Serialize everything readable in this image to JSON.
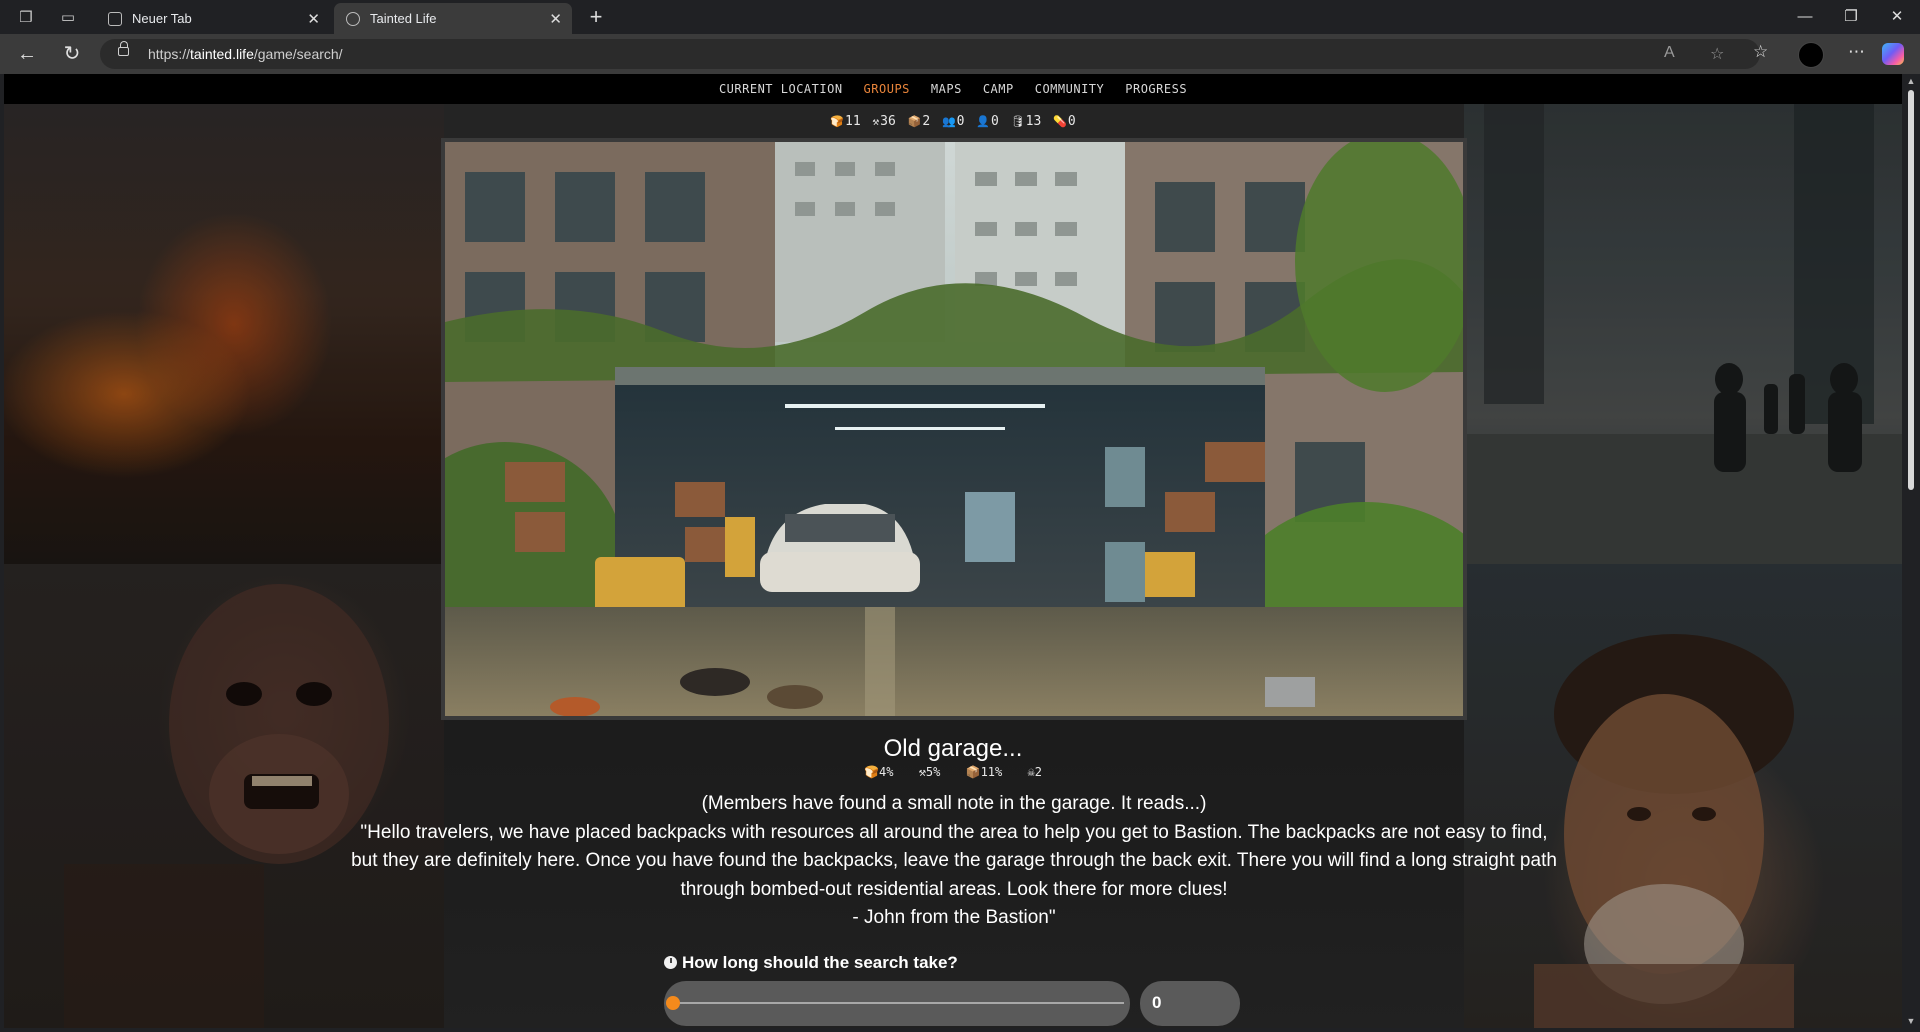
{
  "browser": {
    "tabs": [
      {
        "title": "Neuer Tab",
        "active": false
      },
      {
        "title": "Tainted Life",
        "active": true
      }
    ],
    "url_prefix": "https://",
    "url_host": "tainted.life",
    "url_path": "/game/search/"
  },
  "nav": {
    "items": [
      "CURRENT LOCATION",
      "GROUPS",
      "MAPS",
      "CAMP",
      "COMMUNITY",
      "PROGRESS"
    ],
    "active": "GROUPS"
  },
  "stats": [
    {
      "icon": "food-icon",
      "glyph": "🍞",
      "value": "11"
    },
    {
      "icon": "tools-icon",
      "glyph": "⚒",
      "value": "36"
    },
    {
      "icon": "materials-icon",
      "glyph": "📦",
      "value": "2"
    },
    {
      "icon": "group-icon",
      "glyph": "👥",
      "value": "0"
    },
    {
      "icon": "person-icon",
      "glyph": "👤",
      "value": "0"
    },
    {
      "icon": "fuel-icon",
      "glyph": "🛢",
      "value": "13"
    },
    {
      "icon": "medicine-icon",
      "glyph": "💊",
      "value": "0"
    }
  ],
  "location": {
    "title": "Old garage...",
    "loot": [
      {
        "icon": "food-icon",
        "glyph": "🍞",
        "value": "4%"
      },
      {
        "icon": "tools-icon",
        "glyph": "⚒",
        "value": "5%"
      },
      {
        "icon": "materials-icon",
        "glyph": "📦",
        "value": "11%"
      },
      {
        "icon": "danger-icon",
        "glyph": "☠",
        "value": "2"
      }
    ],
    "story": [
      "(Members have found a small note in the garage. It reads...)",
      "\"Hello travelers, we have placed backpacks with resources all around the area to help you get to Bastion. The backpacks are not easy to find,",
      "but they are definitely here. Once you have found the backpacks, leave the garage through the back exit. There you will find a long straight path",
      "through bombed-out residential areas. Look there for more clues!",
      "- John from the Bastion\""
    ]
  },
  "search": {
    "question": "How long should the search take?",
    "duration_value": "0",
    "slider_fraction": 0
  },
  "colors": {
    "accent": "#f48a1c",
    "nav_active": "#e8843a"
  }
}
